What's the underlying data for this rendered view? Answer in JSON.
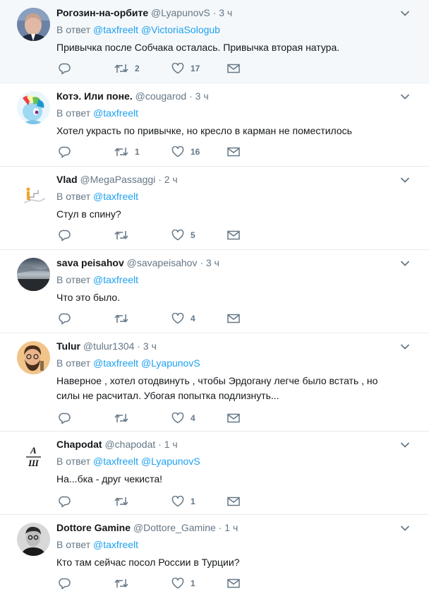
{
  "ui": {
    "reply_prefix": "В ответ",
    "dot": "·"
  },
  "colors": {
    "link": "#1da1f2",
    "meta": "#657786",
    "text": "#14171a",
    "highlight_bg": "#f5f8fa",
    "divider": "#e6ecf0"
  },
  "tweets": [
    {
      "name": "Рогозин-на-орбите",
      "handle": "@LyapunovS",
      "time": "3 ч",
      "mentions": [
        "@taxfreelt",
        "@VictoriaSologub"
      ],
      "text": "Привычка после Собчака осталась. Привычка вторая натура.",
      "retweets": "2",
      "likes": "17",
      "highlighted": true
    },
    {
      "name": "Котэ. Или поне.",
      "handle": "@cougarod",
      "time": "3 ч",
      "mentions": [
        "@taxfreelt"
      ],
      "text": "Хотел украсть по привычке, но кресло в карман не поместилось",
      "retweets": "1",
      "likes": "16",
      "highlighted": false
    },
    {
      "name": "Vlad",
      "handle": "@MegaPassaggi",
      "time": "2 ч",
      "mentions": [
        "@taxfreelt"
      ],
      "text": "Стул в спину?",
      "retweets": "",
      "likes": "5",
      "highlighted": false
    },
    {
      "name": "sava peisahov",
      "handle": "@savapeisahov",
      "time": "3 ч",
      "mentions": [
        "@taxfreelt"
      ],
      "text": "Что это было.",
      "retweets": "",
      "likes": "4",
      "highlighted": false
    },
    {
      "name": "Tulur",
      "handle": "@tulur1304",
      "time": "3 ч",
      "mentions": [
        "@taxfreelt",
        "@LyapunovS"
      ],
      "text": "Наверное , хотел отодвинуть , чтобы Эрдогану легче было встать , но силы не расчитал. Убогая попытка подлизнуть...",
      "retweets": "",
      "likes": "4",
      "highlighted": false
    },
    {
      "name": "Chapodat",
      "handle": "@chapodat",
      "time": "1 ч",
      "mentions": [
        "@taxfreelt",
        "@LyapunovS"
      ],
      "text": "На...бка - друг чекиста!",
      "retweets": "",
      "likes": "1",
      "highlighted": false
    },
    {
      "name": "Dottore Gamine",
      "handle": "@Dottore_Gamine",
      "time": "1 ч",
      "mentions": [
        "@taxfreelt"
      ],
      "text": "Кто там сейчас посол России в Турции?",
      "retweets": "",
      "likes": "1",
      "highlighted": false
    }
  ],
  "avatar_icons": [
    "man-portrait-icon",
    "rainbow-pony-icon",
    "figure-stairs-icon",
    "sky-landscape-icon",
    "bearded-man-icon",
    "letters-logo-icon",
    "bw-portrait-icon"
  ],
  "logo_letters": [
    "А",
    "Ш"
  ]
}
